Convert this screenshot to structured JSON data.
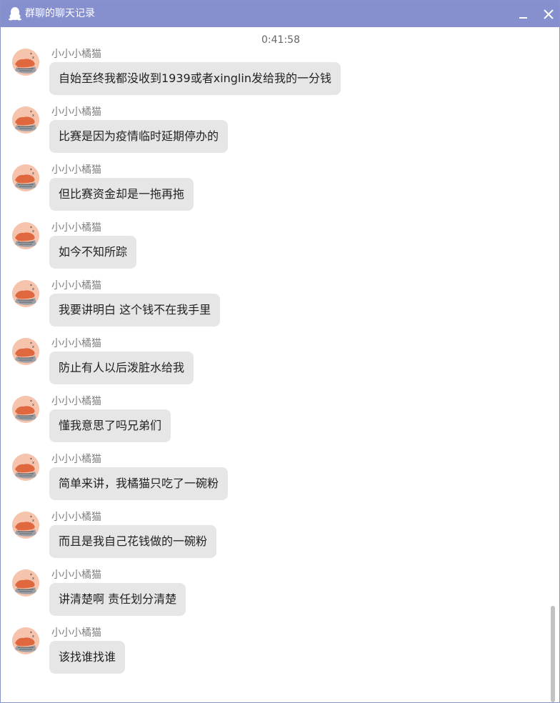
{
  "window": {
    "title": "群聊的聊天记录"
  },
  "timestamp": "0:41:58",
  "messages": [
    {
      "sender": "小小小橘猫",
      "text": "自始至终我都没收到1939或者xinglin发给我的一分钱"
    },
    {
      "sender": "小小小橘猫",
      "text": "比赛是因为疫情临时延期停办的"
    },
    {
      "sender": "小小小橘猫",
      "text": "但比赛资金却是一拖再拖"
    },
    {
      "sender": "小小小橘猫",
      "text": "如今不知所踪"
    },
    {
      "sender": "小小小橘猫",
      "text": "我要讲明白 这个钱不在我手里"
    },
    {
      "sender": "小小小橘猫",
      "text": "防止有人以后泼脏水给我"
    },
    {
      "sender": "小小小橘猫",
      "text": "懂我意思了吗兄弟们"
    },
    {
      "sender": "小小小橘猫",
      "text": "简单来讲，我橘猫只吃了一碗粉"
    },
    {
      "sender": "小小小橘猫",
      "text": "而且是我自己花钱做的一碗粉"
    },
    {
      "sender": "小小小橘猫",
      "text": "讲清楚啊 责任划分清楚"
    },
    {
      "sender": "小小小橘猫",
      "text": "该找谁找谁"
    }
  ],
  "icons": {
    "title": "qq-penguin-icon",
    "minimize": "minimize-icon",
    "close": "close-icon",
    "avatar": "cat-avatar-icon"
  },
  "colors": {
    "titlebar": "#8790cf",
    "bubble": "#e6e6e6",
    "sender": "#808080"
  }
}
